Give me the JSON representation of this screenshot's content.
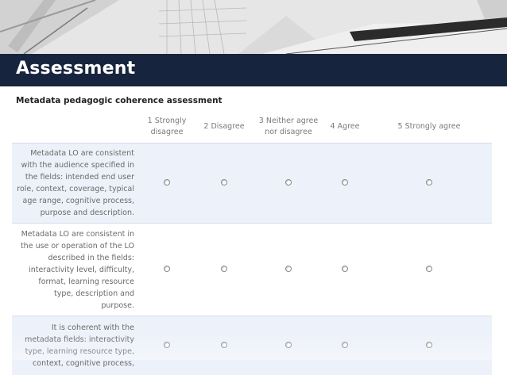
{
  "page": {
    "title": "Assessment"
  },
  "section": {
    "title": "Metadata pedagogic coherence assessment"
  },
  "scale": {
    "options": [
      "1 Strongly disagree",
      "2 Disagree",
      "3 Neither agree nor disagree",
      "4 Agree",
      "5 Strongly agree"
    ]
  },
  "questions": [
    {
      "lines": [
        "Metadata LO are consistent",
        "with the audience specified in",
        "the fields: intended end user",
        "role, context, coverage, typical",
        "age range, cognitive process,",
        "purpose and description."
      ]
    },
    {
      "lines": [
        "Metadata LO are consistent in",
        "the use or operation of the LO",
        "described in the fields:",
        "interactivity level, difficulty,",
        "format, learning resource",
        "type, description and",
        "purpose."
      ]
    },
    {
      "lines": [
        "It is coherent with the",
        "metadata fields: interactivity",
        "type, learning resource type,",
        "context, cognitive process,"
      ]
    }
  ]
}
